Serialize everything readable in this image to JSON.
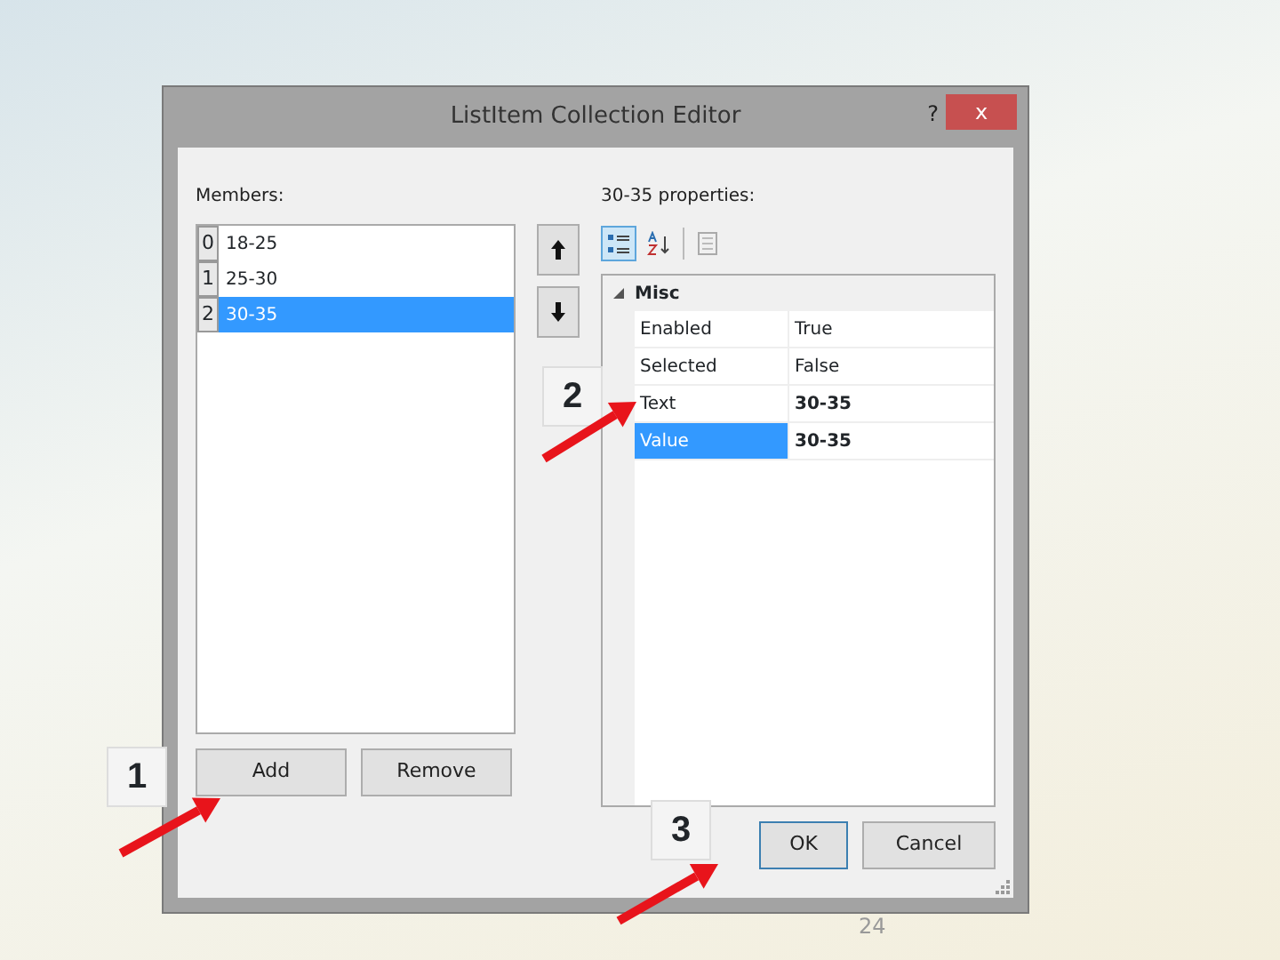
{
  "window": {
    "title": "ListItem Collection Editor",
    "help": "?",
    "close": "x"
  },
  "members": {
    "label": "Members:",
    "items": [
      {
        "index": "0",
        "text": "18-25",
        "selected": false
      },
      {
        "index": "1",
        "text": "25-30",
        "selected": false
      },
      {
        "index": "2",
        "text": "30-35",
        "selected": true
      }
    ]
  },
  "properties": {
    "label": "30-35 properties:",
    "toolbar": [
      {
        "kind": "categorized",
        "selected": true
      },
      {
        "kind": "alphabetical",
        "selected": false
      },
      {
        "kind": "pages",
        "selected": false
      }
    ],
    "category": {
      "name": "Misc",
      "expanded": true
    },
    "rows": [
      {
        "name": "Enabled",
        "value": "True",
        "selected": false,
        "modified": false
      },
      {
        "name": "Selected",
        "value": "False",
        "selected": false,
        "modified": false
      },
      {
        "name": "Text",
        "value": "30-35",
        "selected": false,
        "modified": true
      },
      {
        "name": "Value",
        "value": "30-35",
        "selected": true,
        "modified": true
      }
    ]
  },
  "buttons": [
    {
      "kind": "add",
      "label": "Add",
      "default": false
    },
    {
      "kind": "remove",
      "label": "Remove",
      "default": false
    },
    {
      "kind": "ok",
      "label": "OK",
      "default": true
    },
    {
      "kind": "cancel",
      "label": "Cancel",
      "default": false
    }
  ],
  "callouts": [
    {
      "label": "1"
    },
    {
      "label": "2"
    },
    {
      "label": "3"
    }
  ],
  "slide_number": "24"
}
